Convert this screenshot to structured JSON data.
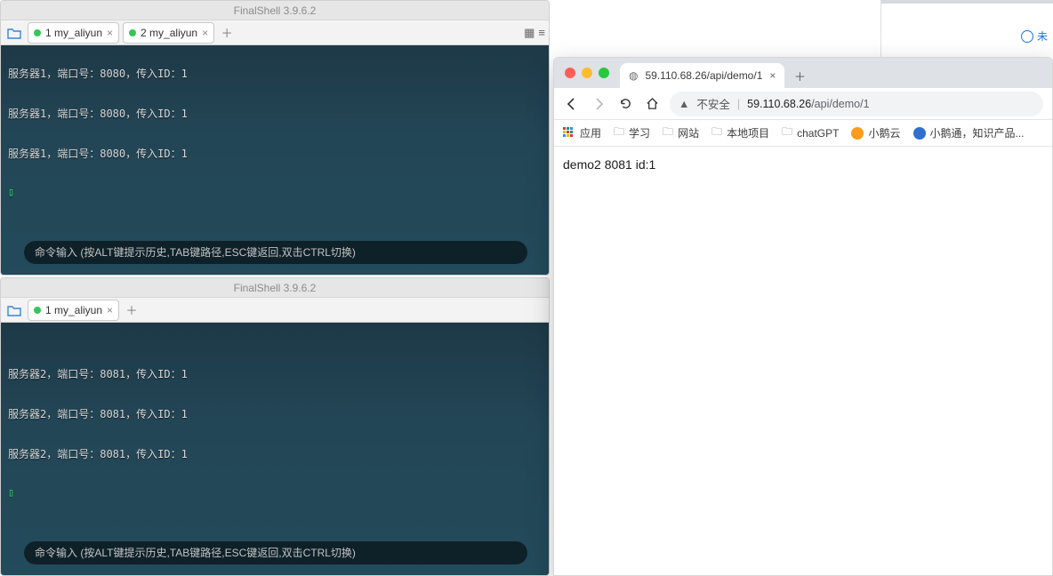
{
  "finalshell": {
    "app_title": "FinalShell 3.9.6.2",
    "tabs_top": [
      {
        "label": "1 my_aliyun"
      },
      {
        "label": "2 my_aliyun"
      }
    ],
    "tabs_bot": [
      {
        "label": "1 my_aliyun"
      }
    ],
    "terminal_top_lines": [
      "服务器1，端口号：8080，传入ID：1",
      "服务器1，端口号：8080，传入ID：1",
      "服务器1，端口号：8080，传入ID：1"
    ],
    "terminal_bot_lines": [
      "服务器2，端口号：8081，传入ID：1",
      "服务器2，端口号：8081，传入ID：1",
      "服务器2，端口号：8081，传入ID：1"
    ],
    "cursor": "▯",
    "cmd_placeholder": "命令输入 (按ALT键提示历史,TAB键路径,ESC键返回,双击CTRL切换)"
  },
  "browser": {
    "tab_title": "59.110.68.26/api/demo/1",
    "insecure_label": "不安全",
    "url_host": "59.110.68.26",
    "url_path": "/api/demo/1",
    "page_body": "demo2 8081 id:1",
    "bookmarks": [
      {
        "kind": "apps",
        "label": "应用"
      },
      {
        "kind": "folder",
        "label": "学习"
      },
      {
        "kind": "folder",
        "label": "网站"
      },
      {
        "kind": "folder",
        "label": "本地项目"
      },
      {
        "kind": "folder",
        "label": "chatGPT"
      },
      {
        "kind": "orange",
        "label": "小鹅云"
      },
      {
        "kind": "blue",
        "label": "小鹅通，知识产品..."
      }
    ]
  },
  "bg": {
    "badge": "未"
  }
}
